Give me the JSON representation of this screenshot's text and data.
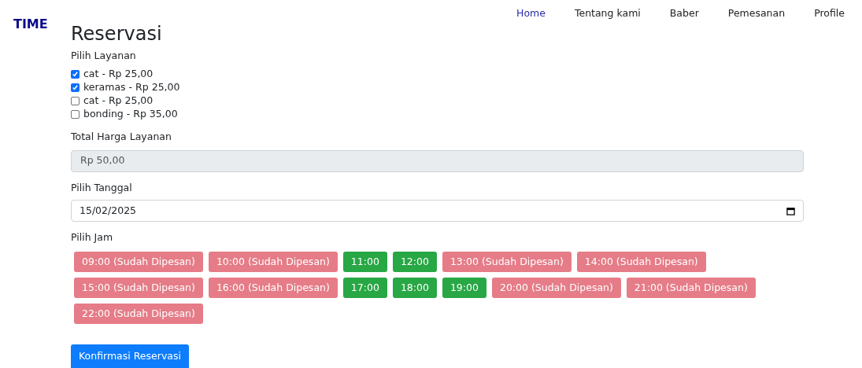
{
  "logo": "TIME",
  "nav": [
    {
      "label": "Home",
      "selected": true
    },
    {
      "label": "Tentang kami",
      "selected": false
    },
    {
      "label": "Baber",
      "selected": false
    },
    {
      "label": "Pemesanan",
      "selected": false
    },
    {
      "label": "Profile",
      "selected": false
    }
  ],
  "title": "Reservasi",
  "services": {
    "label": "Pilih Layanan",
    "items": [
      {
        "label": "cat - Rp 25,00",
        "checked": true
      },
      {
        "label": "keramas - Rp 25,00",
        "checked": true
      },
      {
        "label": "cat - Rp 25,00",
        "checked": false
      },
      {
        "label": "bonding - Rp 35,00",
        "checked": false
      }
    ]
  },
  "total": {
    "label": "Total Harga Layanan",
    "value": "Rp 50,00"
  },
  "date": {
    "label": "Pilih Tanggal",
    "value": "15/02/2025"
  },
  "time": {
    "label": "Pilih Jam",
    "slots": [
      {
        "label": "09:00 (Sudah Dipesan)",
        "booked": true
      },
      {
        "label": "10:00 (Sudah Dipesan)",
        "booked": true
      },
      {
        "label": "11:00",
        "booked": false
      },
      {
        "label": "12:00",
        "booked": false
      },
      {
        "label": "13:00 (Sudah Dipesan)",
        "booked": true
      },
      {
        "label": "14:00 (Sudah Dipesan)",
        "booked": true
      },
      {
        "label": "15:00 (Sudah Dipesan)",
        "booked": true
      },
      {
        "label": "16:00 (Sudah Dipesan)",
        "booked": true
      },
      {
        "label": "17:00",
        "booked": false
      },
      {
        "label": "18:00",
        "booked": false
      },
      {
        "label": "19:00",
        "booked": false
      },
      {
        "label": "20:00 (Sudah Dipesan)",
        "booked": true
      },
      {
        "label": "21:00 (Sudah Dipesan)",
        "booked": true
      },
      {
        "label": "22:00 (Sudah Dipesan)",
        "booked": true
      }
    ]
  },
  "submit": "Konfirmasi Reservasi"
}
